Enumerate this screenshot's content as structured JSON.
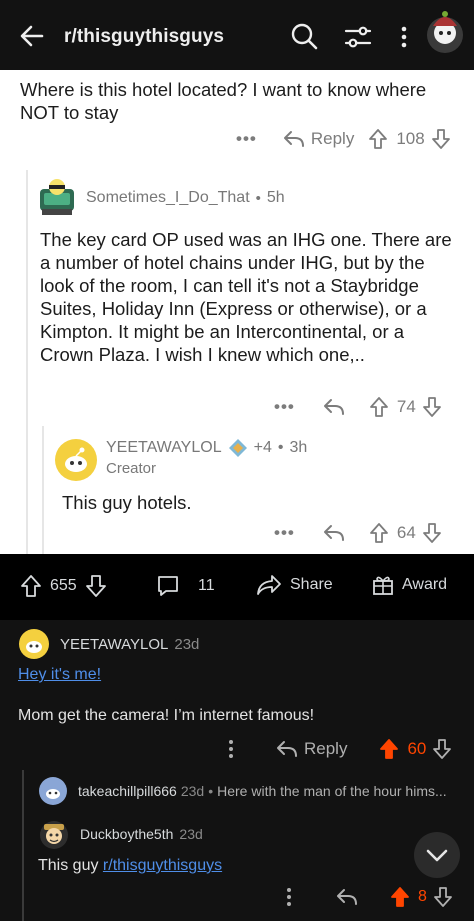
{
  "topbar": {
    "title": "r/thisguythisguys"
  },
  "parent": {
    "text": "Where is this hotel located? I want to know where NOT to stay",
    "reply_label": "Reply",
    "score": "108"
  },
  "comment1": {
    "username": "Sometimes_I_Do_That",
    "age": "5h",
    "text": "The key card OP used was an IHG one.  There are a number of hotel chains under IHG, but by the look of the room, I can tell it's not a Staybridge Suites, Holiday Inn (Express or otherwise), or a Kimpton.  It might be an Intercontinental, or a Crown Plaza.  I wish I knew which one,..",
    "score": "74"
  },
  "comment2": {
    "username": "YEETAWAYLOL",
    "award_count": "+4",
    "age": "3h",
    "flair": "Creator",
    "text": "This guy hotels.",
    "score": "64"
  },
  "postbar": {
    "score": "655",
    "comments": "11",
    "share": "Share",
    "award": "Award"
  },
  "dark1": {
    "username": "YEETAWAYLOL",
    "age": "23d",
    "link": "Hey it's me!",
    "text": "Mom get the camera! I’m internet famous!",
    "reply_label": "Reply",
    "score": "60"
  },
  "dark2": {
    "username": "takeachillpill666",
    "age": "23d",
    "preview": "Here with the man of the hour hims..."
  },
  "dark3": {
    "username": "Duckboythe5th",
    "age": "23d",
    "text": "This guy",
    "link": "r/thisguythisguys",
    "score": "8"
  },
  "colors": {
    "upvote_active": "#ff4500",
    "link": "#4f8ee8"
  }
}
